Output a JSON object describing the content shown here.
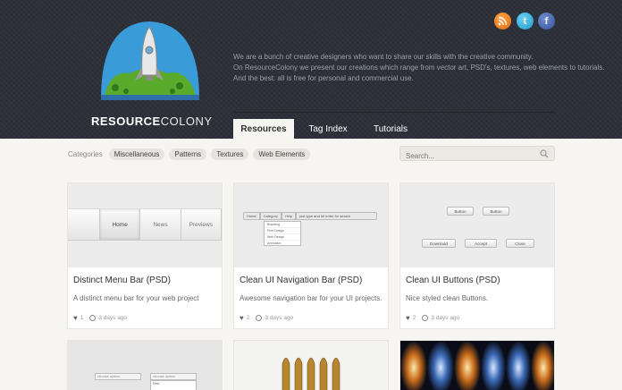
{
  "header": {
    "brand_bold": "RESOURCE",
    "brand_light": "COLONY",
    "intro": [
      "We are a bunch of creative designers who want to share our skills with the creative community.",
      "On ResourceColony we present our creations which range from vector art, PSD's, textures, web elements to tutorials.",
      "And the best: all is free for personal and commercial use."
    ],
    "social": [
      "rss-icon",
      "twitter-icon",
      "facebook-icon"
    ],
    "tabs": [
      "Resources",
      "Tag Index",
      "Tutorials"
    ]
  },
  "filters": {
    "label": "Categories",
    "chips": [
      "Miscellaneous",
      "Patterns",
      "Textures",
      "Web Elements"
    ]
  },
  "search": {
    "placeholder": "Search..."
  },
  "cards": [
    {
      "title": "Distinct Menu Bar (PSD)",
      "desc": "A distinct menu bar for your web project",
      "likes": "1",
      "time": "3 days ago",
      "thumb": {
        "items": [
          "Home",
          "News",
          "Previews"
        ]
      }
    },
    {
      "title": "Clean UI Navigation Bar (PSD)",
      "desc": "Awesome navigation bar for your UI projects.",
      "likes": "2",
      "time": "3 days ago",
      "thumb": {
        "nav": [
          "Home",
          "Category",
          "Help",
          "just type and hit enter for search"
        ],
        "dropdown": [
          "Branding",
          "Print Design",
          "Web Design",
          "Animation"
        ]
      }
    },
    {
      "title": "Clean UI Buttons (PSD)",
      "desc": "Nice styled clean Buttons.",
      "likes": "2",
      "time": "3 days ago",
      "thumb": {
        "buttons": [
          "Button",
          "Button",
          "Download",
          "Accept",
          "Close"
        ]
      }
    }
  ],
  "row2": {
    "card1": {
      "select_a": "choose option",
      "select_b": "choose option",
      "option": "Red"
    }
  },
  "colors": {
    "header_bg": "#2d3038",
    "page_bg": "#f6f5f1",
    "rss": "#e36c0a",
    "twitter": "#1f98c9",
    "facebook": "#34519a"
  }
}
